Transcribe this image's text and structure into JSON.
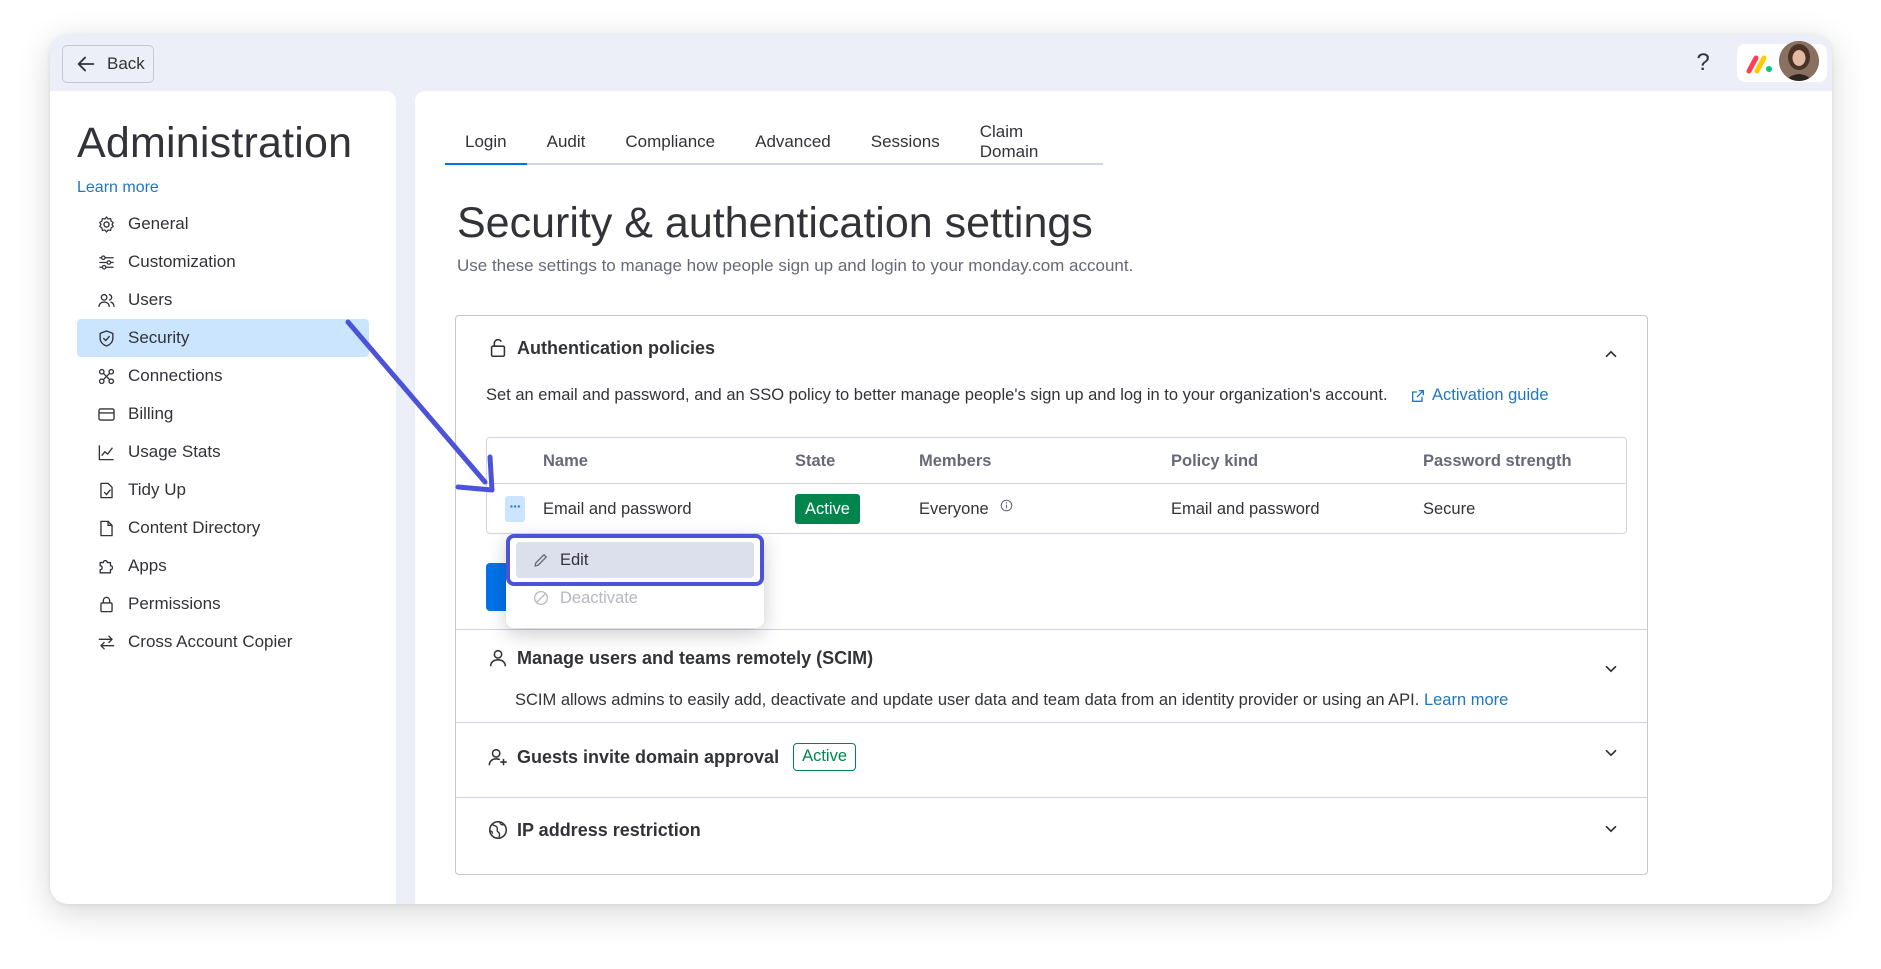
{
  "topbar": {
    "back_label": "Back",
    "help_glyph": "?"
  },
  "sidebar": {
    "title": "Administration",
    "learn_more": "Learn more",
    "items": [
      {
        "label": "General",
        "icon": "gear-icon"
      },
      {
        "label": "Customization",
        "icon": "sliders-icon"
      },
      {
        "label": "Users",
        "icon": "users-icon"
      },
      {
        "label": "Security",
        "icon": "shield-icon",
        "active": true
      },
      {
        "label": "Connections",
        "icon": "connections-icon"
      },
      {
        "label": "Billing",
        "icon": "credit-card-icon"
      },
      {
        "label": "Usage Stats",
        "icon": "chart-icon"
      },
      {
        "label": "Tidy Up",
        "icon": "broom-icon"
      },
      {
        "label": "Content Directory",
        "icon": "document-icon"
      },
      {
        "label": "Apps",
        "icon": "puzzle-icon"
      },
      {
        "label": "Permissions",
        "icon": "lock-icon"
      },
      {
        "label": "Cross Account Copier",
        "icon": "transfer-icon"
      }
    ]
  },
  "tabs": [
    "Login",
    "Audit",
    "Compliance",
    "Advanced",
    "Sessions",
    "Claim Domain"
  ],
  "active_tab": "Login",
  "main": {
    "title": "Security & authentication settings",
    "subtitle": "Use these settings to manage how people sign up and login to your monday.com account."
  },
  "auth_policies": {
    "title": "Authentication policies",
    "description": "Set an email and password, and an SSO policy to better manage people's sign up and log in to your organization's account.",
    "guide_link": "Activation guide",
    "columns": [
      "Name",
      "State",
      "Members",
      "Policy kind",
      "Password strength"
    ],
    "row": {
      "actions_glyph": "···",
      "name": "Email and password",
      "state": "Active",
      "members": "Everyone",
      "policy_kind": "Email and password",
      "password_strength": "Secure"
    }
  },
  "context_menu": {
    "edit": "Edit",
    "deactivate": "Deactivate"
  },
  "scim": {
    "title": "Manage users and teams remotely (SCIM)",
    "description": "SCIM allows admins to easily add, deactivate and update user data and team data from an identity provider or using an API.",
    "link": "Learn more"
  },
  "guests": {
    "title": "Guests invite domain approval",
    "badge": "Active"
  },
  "ip": {
    "title": "IP address restriction"
  },
  "colors": {
    "accent": "#0073ea",
    "link": "#1f76c2",
    "active_green": "#00854d",
    "selected_bg": "#cce5ff",
    "annotation": "#4d53d6"
  }
}
